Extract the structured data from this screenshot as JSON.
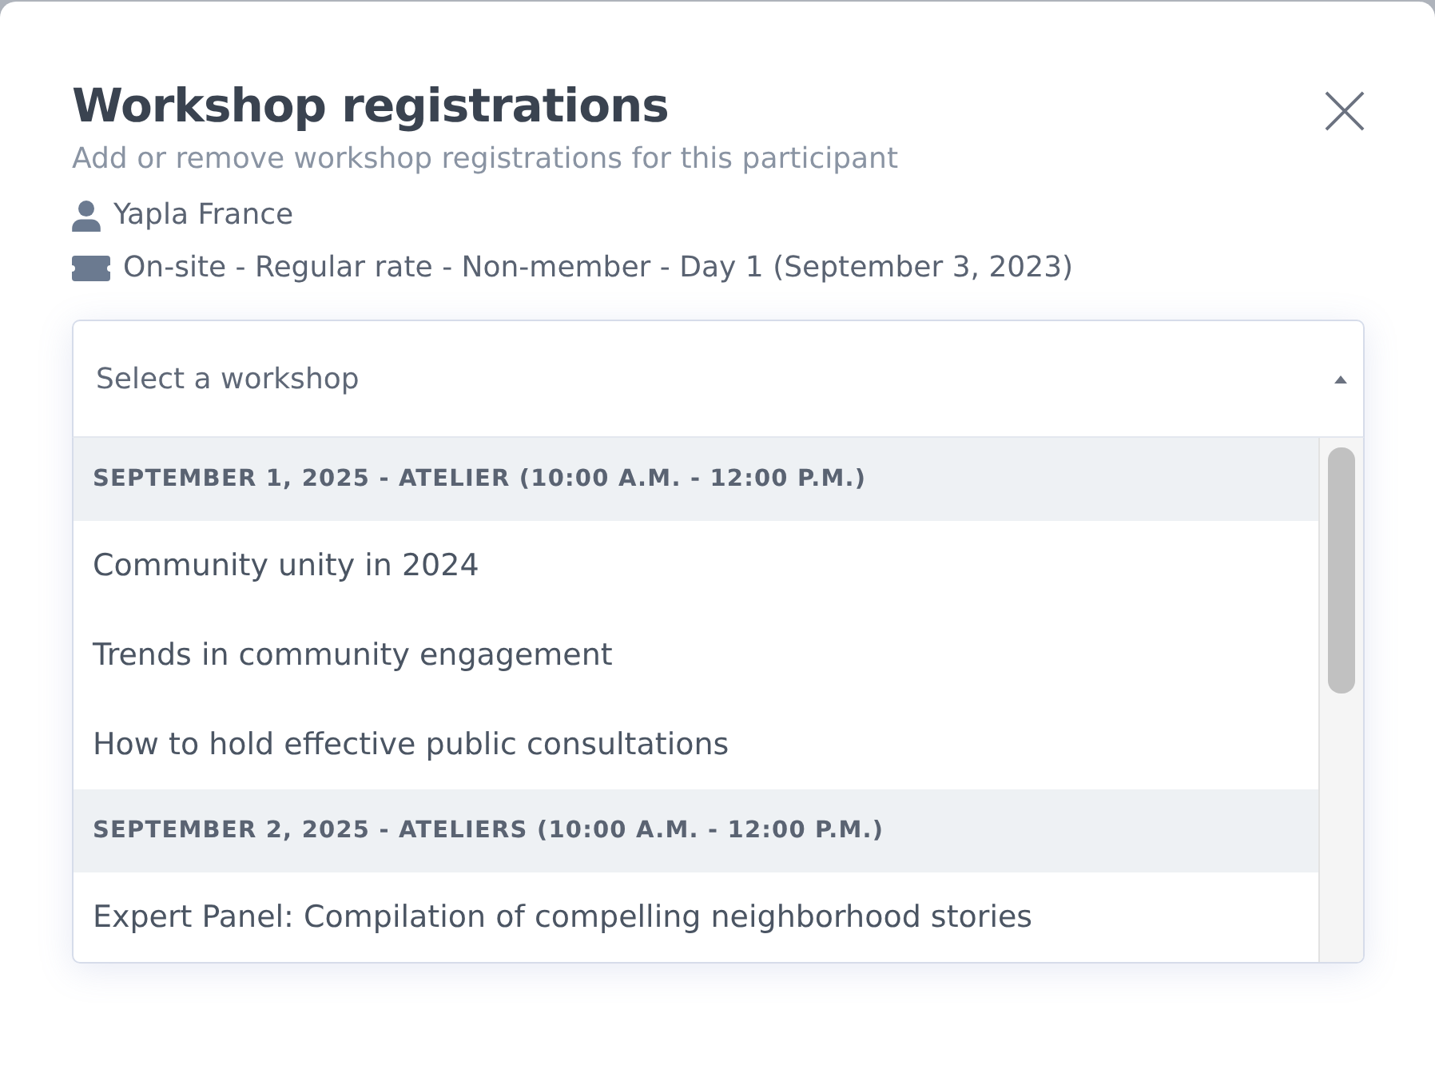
{
  "dialog": {
    "title": "Workshop registrations",
    "subtitle": "Add or remove workshop registrations for this participant",
    "participant": "Yapla France",
    "ticket": "On-site - Regular rate - Non-member - Day 1 (September 3, 2023)"
  },
  "workshop_select": {
    "placeholder": "Select a workshop",
    "expanded": true,
    "items": [
      {
        "kind": "group",
        "label": "SEPTEMBER 1, 2025 - ATELIER (10:00 A.M. - 12:00 P.M.)"
      },
      {
        "kind": "option",
        "label": "Community unity in 2024"
      },
      {
        "kind": "option",
        "label": "Trends in community engagement"
      },
      {
        "kind": "option",
        "label": "How to hold effective public consultations"
      },
      {
        "kind": "group",
        "label": "SEPTEMBER 2, 2025 - ATELIERS (10:00 A.M. - 12:00 P.M.)"
      },
      {
        "kind": "option",
        "label": "Expert Panel: Compilation of compelling neighborhood stories"
      }
    ]
  }
}
